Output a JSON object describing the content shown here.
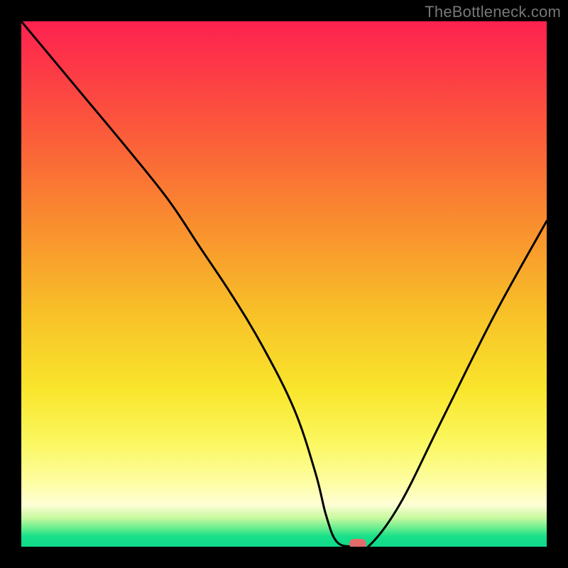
{
  "watermark": "TheBottleneck.com",
  "chart_data": {
    "type": "line",
    "title": "",
    "xlabel": "",
    "ylabel": "",
    "xlim": [
      0,
      100
    ],
    "ylim": [
      0,
      100
    ],
    "grid": false,
    "legend": false,
    "background_gradient": {
      "orientation": "vertical",
      "stops": [
        {
          "pos": 0,
          "color": "#fd2251"
        },
        {
          "pos": 22,
          "color": "#fb5d3a"
        },
        {
          "pos": 40,
          "color": "#f9922e"
        },
        {
          "pos": 56,
          "color": "#f8c228"
        },
        {
          "pos": 70,
          "color": "#f9e52c"
        },
        {
          "pos": 88,
          "color": "#fefea5"
        },
        {
          "pos": 96,
          "color": "#65ed8e"
        },
        {
          "pos": 100,
          "color": "#11d98a"
        }
      ]
    },
    "series": [
      {
        "name": "bottleneck-curve",
        "color": "#000000",
        "x": [
          0,
          10,
          20,
          28,
          34,
          40,
          46,
          52,
          56,
          58,
          60,
          63,
          66,
          72,
          80,
          90,
          100
        ],
        "y": [
          100,
          88,
          76,
          66,
          57,
          48,
          38,
          26,
          14,
          6,
          1,
          0,
          0,
          8,
          24,
          44,
          62
        ]
      }
    ],
    "marker": {
      "name": "optimal-point",
      "x": 64,
      "y": 0,
      "color": "#e46a6b"
    }
  }
}
